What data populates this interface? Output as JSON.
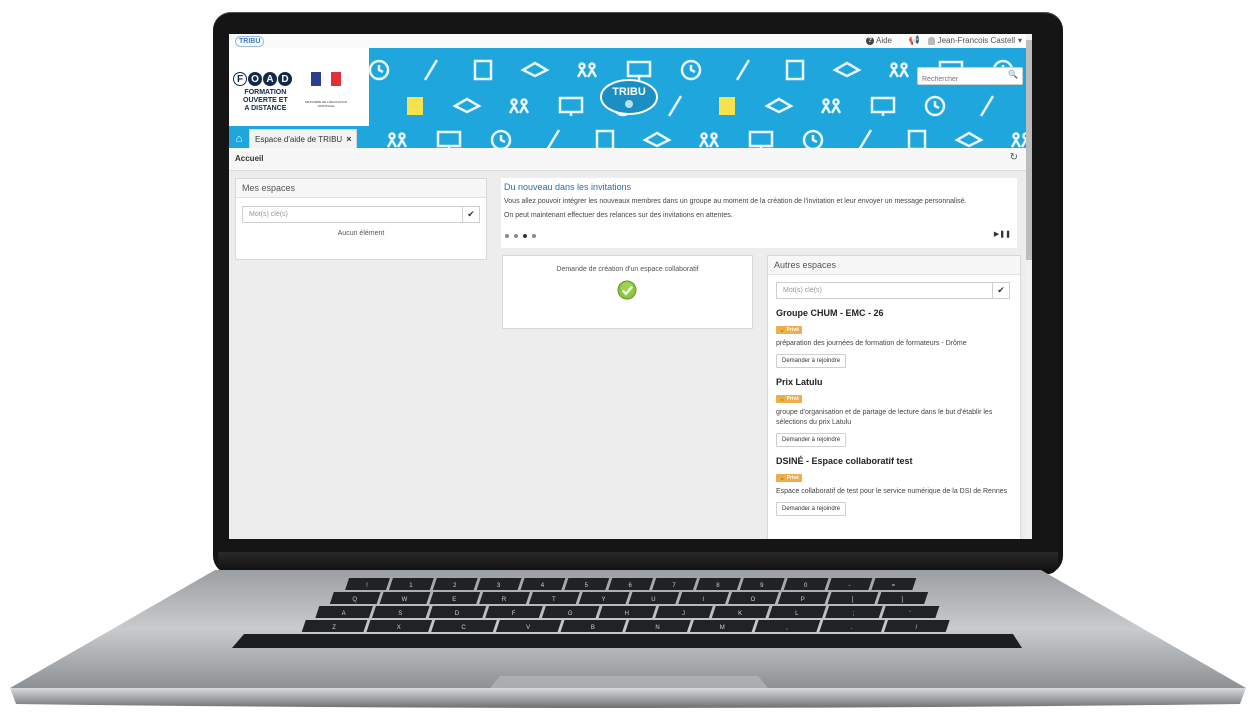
{
  "topbar": {
    "app_mini_logo": "TRIBU",
    "help": "Aide",
    "user": "Jean-Francois Castell",
    "help_icon": "question-circle-icon",
    "notif_icon": "bullhorn-icon",
    "user_icon": "user-icon",
    "caret_icon": "caret-down-icon"
  },
  "banner": {
    "foad_letters": [
      "F",
      "O",
      "A",
      "D"
    ],
    "foad_lines": [
      "FORMATION",
      "OUVERTE ET",
      "A DISTANCE"
    ],
    "ministry": "MINISTÈRE DE L'ÉDUCATION NATIONALE",
    "logo": "TRIBU",
    "search_placeholder": "Rechercher",
    "background_color": "#1fa6dd"
  },
  "tabs": {
    "home_icon": "home-icon",
    "items": [
      {
        "label": "Espace d'aide de TRIBU",
        "close": "×"
      }
    ]
  },
  "breadcrumb": {
    "label": "Accueil",
    "refresh_icon": "refresh-icon"
  },
  "mes_espaces": {
    "title": "Mes espaces",
    "keyword_placeholder": "Mot(s) clé(s)",
    "empty": "Aucun élément"
  },
  "news": {
    "title": "Du nouveau dans les invitations",
    "lines": [
      "Vous allez pouvoir intégrer les nouveaux membres dans un groupe au moment de la création de l'invitation et leur envoyer un message personnalisé.",
      "On peut maintenant effectuer des relances sur des invitations en attentes."
    ],
    "dot_count": 4,
    "active_dot": 2,
    "controls": "▶❚❚"
  },
  "demande": {
    "label": "Demande de création d'un espace collaboratif",
    "icon": "check-circle-icon"
  },
  "autres_espaces": {
    "title": "Autres espaces",
    "keyword_placeholder": "Mot(s) clé(s)",
    "items": [
      {
        "name": "Groupe CHUM - EMC - 26",
        "badge": "Privé",
        "description": "préparation des journées de formation de formateurs - Drôme",
        "action": "Demander à rejoindre"
      },
      {
        "name": "Prix Latulu",
        "badge": "Privé",
        "description": "groupe d'organisation et de partage de lecture dans le but d'établir les sélections du prix Latulu",
        "action": "Demander à rejoindre"
      },
      {
        "name": "DSINÉ - Espace collaboratif test",
        "badge": "Privé",
        "description": "Espace collaboratif de test pour le service numérique de la DSI de Rennes",
        "action": "Demander à rejoindre"
      }
    ]
  },
  "keyboard": {
    "row1": [
      "!",
      "1",
      "2",
      "3",
      "4",
      "5",
      "6",
      "7",
      "8",
      "9",
      "0",
      "-",
      "="
    ],
    "row2": [
      "Q",
      "W",
      "E",
      "R",
      "T",
      "Y",
      "U",
      "I",
      "O",
      "P",
      "[",
      "]"
    ],
    "row3": [
      "A",
      "S",
      "D",
      "F",
      "G",
      "H",
      "J",
      "K",
      "L",
      ";",
      "'"
    ],
    "row4": [
      "Z",
      "X",
      "C",
      "V",
      "B",
      "N",
      "M",
      ",",
      ".",
      "/"
    ]
  }
}
